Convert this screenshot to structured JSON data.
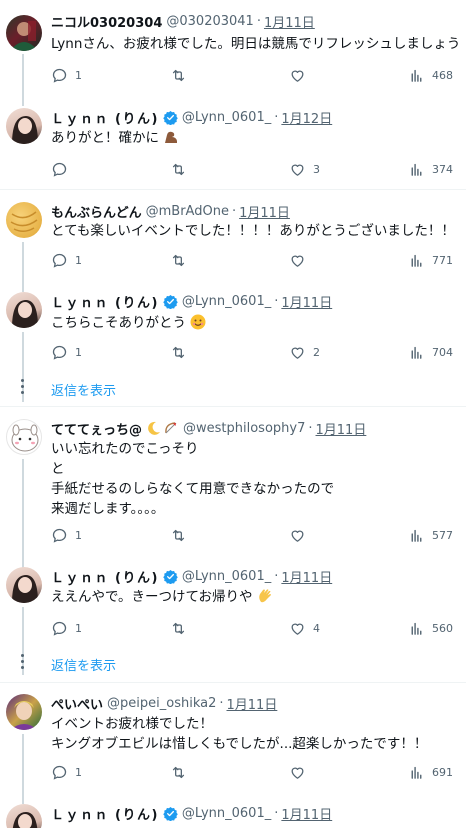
{
  "tweets": [
    {
      "name": "ニコル03020304",
      "handle": "@030203041",
      "date": "1月11日",
      "lines": [
        "Lynnさん、お疲れ様でした。明日は競馬でリフレッシュしましょう"
      ],
      "replies": "1",
      "likes": "",
      "views": "468"
    },
    {
      "name": "Ｌｙｎｎ (りん)",
      "handle": "@Lynn_0601_",
      "date": "1月12日",
      "lines": [
        "ありがと！確かに"
      ],
      "replies": "",
      "likes": "3",
      "views": "374"
    },
    {
      "name": "もんぶらんどん",
      "handle": "@mBrAdOne",
      "date": "1月11日",
      "lines": [
        "とても楽しいイベントでした！！！！ありがとうございました！！"
      ],
      "replies": "1",
      "likes": "",
      "views": "771"
    },
    {
      "name": "Ｌｙｎｎ (りん)",
      "handle": "@Lynn_0601_",
      "date": "1月11日",
      "lines": [
        "こちらこそありがとう"
      ],
      "replies": "1",
      "likes": "2",
      "views": "704"
    },
    {
      "name": "てててぇっち@",
      "handle": "@westphilosophy7",
      "date": "1月11日",
      "lines": [
        "いい忘れたのでこっそり",
        "と",
        "手紙だせるのしらなくて用意できなかったので",
        "来週だします。。。。"
      ],
      "replies": "1",
      "likes": "",
      "views": "577"
    },
    {
      "name": "Ｌｙｎｎ (りん)",
      "handle": "@Lynn_0601_",
      "date": "1月11日",
      "lines": [
        "ええんやで。きーつけてお帰りや"
      ],
      "replies": "1",
      "likes": "4",
      "views": "560"
    },
    {
      "name": "ぺいぺい",
      "handle": "@peipei_oshika2",
      "date": "1月11日",
      "lines": [
        "イベントお疲れ様でした！",
        "キングオブエビルは惜しくもでしたが...超楽しかったです！！"
      ],
      "replies": "1",
      "likes": "",
      "views": "691"
    },
    {
      "name": "Ｌｙｎｎ (りん)",
      "handle": "@Lynn_0601_",
      "date": "1月11日",
      "lines": [],
      "replies": "",
      "likes": "",
      "views": ""
    }
  ],
  "show_replies_label": "返信を表示",
  "icons": {
    "reply": "reply-icon",
    "retweet": "retweet-icon",
    "like": "heart-icon",
    "views": "views-icon",
    "verified": "verified-badge-icon"
  },
  "colors": {
    "text": "#0f1419",
    "secondary": "#536471",
    "link": "#1d9bf0",
    "line": "#cfd9de",
    "verified": "#1d9bf0"
  }
}
